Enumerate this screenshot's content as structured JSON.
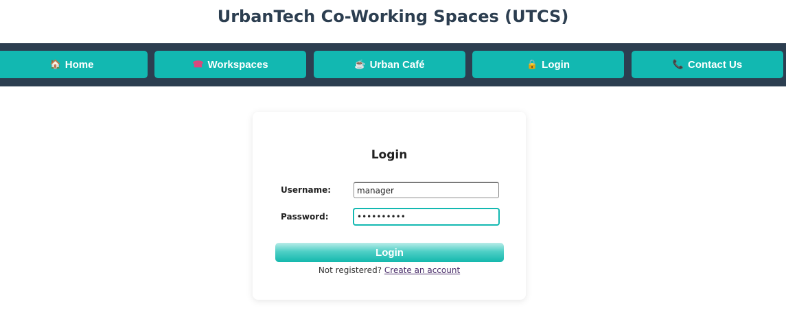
{
  "header": {
    "title": "UrbanTech Co-Working Spaces (UTCS)"
  },
  "nav": {
    "items": [
      {
        "icon": "🏠",
        "label": "Home"
      },
      {
        "icon": "☎",
        "label": "Workspaces"
      },
      {
        "icon": "☕",
        "label": "Urban Café"
      },
      {
        "icon": "🔒",
        "label": "Login"
      },
      {
        "icon": "📞",
        "label": "Contact Us"
      }
    ]
  },
  "login_form": {
    "title": "Login",
    "username_label": "Username:",
    "username_value": "manager",
    "password_label": "Password:",
    "password_value": "••••••••••",
    "submit_label": "Login",
    "register_prompt": "Not registered?",
    "register_link": "Create an account"
  },
  "colors": {
    "nav_bg": "#2c3e50",
    "accent": "#12b8b1",
    "title": "#2c3e50"
  }
}
